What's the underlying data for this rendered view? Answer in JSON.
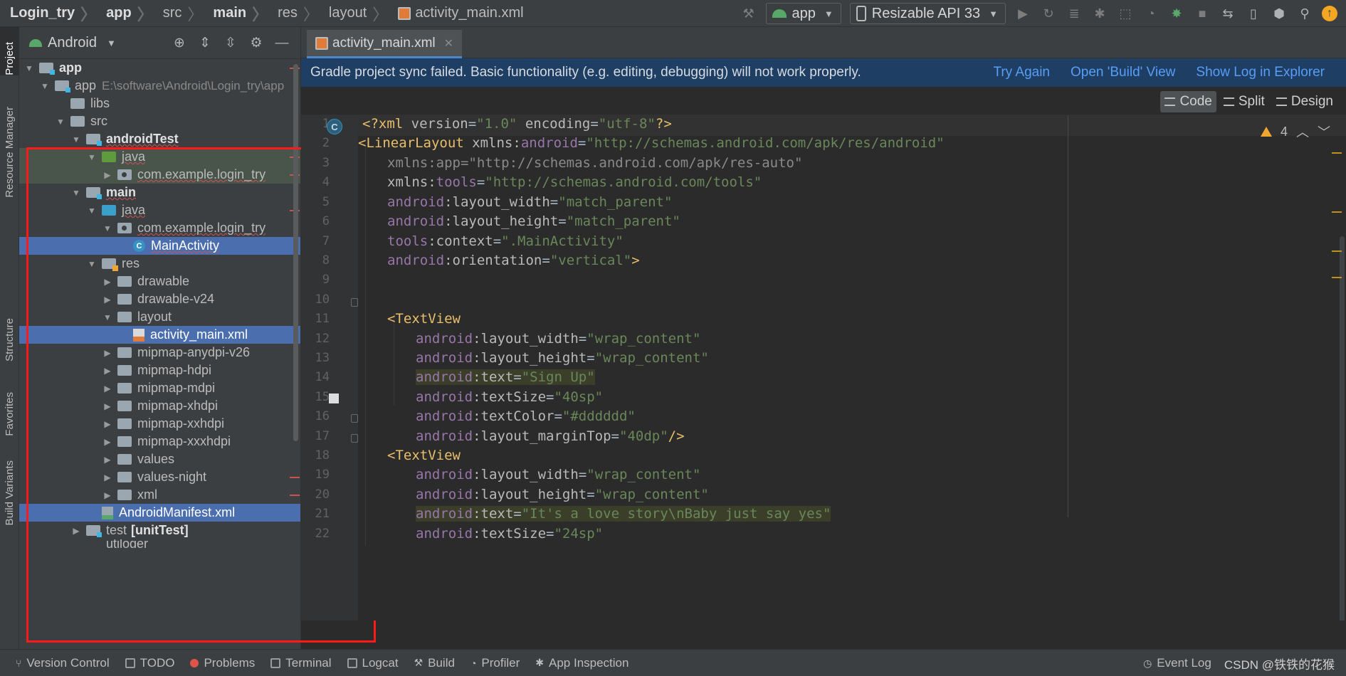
{
  "navbar": {
    "breadcrumbs": [
      "Login_try",
      "app",
      "src",
      "main",
      "res",
      "layout",
      "activity_main.xml"
    ],
    "run_config": "app",
    "device": "Resizable API 33",
    "update_badge": "↑"
  },
  "left_stripe": {
    "tabs": [
      "Project",
      "Resource Manager",
      "Structure",
      "Favorites",
      "Build Variants"
    ]
  },
  "project_panel": {
    "view_mode": "Android",
    "tree": [
      {
        "label": "app",
        "bold": true,
        "expanded": true
      },
      {
        "label": "app",
        "path": "E:\\software\\Android\\Login_try\\app",
        "expanded": true
      },
      {
        "label": "libs"
      },
      {
        "label": "src",
        "expanded": true
      },
      {
        "label": "androidTest",
        "bold": true,
        "expanded": true
      },
      {
        "label": "java",
        "expanded": true
      },
      {
        "label": "com.example.login_try",
        "expanded": false
      },
      {
        "label": "main",
        "bold": true,
        "expanded": true
      },
      {
        "label": "java",
        "expanded": true
      },
      {
        "label": "com.example.login_try",
        "expanded": true
      },
      {
        "label": "MainActivity",
        "selected": true,
        "class_icon": "C"
      },
      {
        "label": "res",
        "expanded": true
      },
      {
        "label": "drawable",
        "expanded": false
      },
      {
        "label": "drawable-v24",
        "expanded": false
      },
      {
        "label": "layout",
        "expanded": true
      },
      {
        "label": "activity_main.xml",
        "selected": true
      },
      {
        "label": "mipmap-anydpi-v26",
        "expanded": false
      },
      {
        "label": "mipmap-hdpi",
        "expanded": false
      },
      {
        "label": "mipmap-mdpi",
        "expanded": false
      },
      {
        "label": "mipmap-xhdpi",
        "expanded": false
      },
      {
        "label": "mipmap-xxhdpi",
        "expanded": false
      },
      {
        "label": "mipmap-xxxhdpi",
        "expanded": false
      },
      {
        "label": "values",
        "expanded": false
      },
      {
        "label": "values-night",
        "expanded": false
      },
      {
        "label": "xml",
        "expanded": false
      },
      {
        "label": "AndroidManifest.xml",
        "selected": true
      },
      {
        "label": "test",
        "suffix": "[unitTest]",
        "expanded": false
      },
      {
        "label": "utiloger"
      }
    ]
  },
  "editor": {
    "tab_title": "activity_main.xml",
    "sync_banner": {
      "message": "Gradle project sync failed. Basic functionality (e.g. editing, debugging) will not work properly.",
      "links": [
        "Try Again",
        "Open 'Build' View",
        "Show Log in Explorer"
      ]
    },
    "modes": [
      "Code",
      "Split",
      "Design"
    ],
    "active_mode": "Code",
    "warning_count": "4",
    "line_numbers": [
      "1",
      "2",
      "3",
      "4",
      "5",
      "6",
      "7",
      "8",
      "9",
      "10",
      "11",
      "12",
      "13",
      "14",
      "15",
      "16",
      "17",
      "18",
      "19",
      "20",
      "21",
      "22"
    ],
    "gutter_class_icon": "C",
    "code": {
      "l1": {
        "pre": "<?xml ",
        "a1": "version",
        "eq1": "=",
        "v1": "\"1.0\"",
        "sp": " ",
        "a2": "encoding",
        "eq2": "=",
        "v2": "\"utf-8\"",
        "post": "?>"
      },
      "l2": {
        "tag": "<LinearLayout",
        "sp": " ",
        "ns": "xmlns:",
        "nsn": "android",
        "eq": "=",
        "val": "\"http://schemas.android.com/apk/res/android\""
      },
      "l3": {
        "text": "xmlns:app=\"http://schemas.android.com/apk/res-auto\""
      },
      "l4": {
        "attr": "xmlns:",
        "ns": "tools",
        "eq": "=",
        "val": "\"http://schemas.android.com/tools\""
      },
      "l5": {
        "ns": "android",
        "attr": ":layout_width",
        "eq": "=",
        "val": "\"match_parent\""
      },
      "l6": {
        "ns": "android",
        "attr": ":layout_height",
        "eq": "=",
        "val": "\"match_parent\""
      },
      "l7": {
        "ns": "tools",
        "attr": ":context",
        "eq": "=",
        "val": "\".MainActivity\""
      },
      "l8": {
        "ns": "android",
        "attr": ":orientation",
        "eq": "=",
        "val": "\"vertical\"",
        "close": ">"
      },
      "l11": {
        "tag": "<TextView"
      },
      "l12": {
        "ns": "android",
        "attr": ":layout_width",
        "eq": "=",
        "val": "\"wrap_content\""
      },
      "l13": {
        "ns": "android",
        "attr": ":layout_height",
        "eq": "=",
        "val": "\"wrap_content\""
      },
      "l14": {
        "ns": "android",
        "attr": ":text",
        "eq": "=",
        "val": "\"Sign Up\""
      },
      "l15": {
        "ns": "android",
        "attr": ":textSize",
        "eq": "=",
        "val": "\"40sp\""
      },
      "l16": {
        "ns": "android",
        "attr": ":textColor",
        "eq": "=",
        "val": "\"#dddddd\""
      },
      "l17": {
        "ns": "android",
        "attr": ":layout_marginTop",
        "eq": "=",
        "val": "\"40dp\"",
        "close": "/>"
      },
      "l18": {
        "tag": "<TextView"
      },
      "l19": {
        "ns": "android",
        "attr": ":layout_width",
        "eq": "=",
        "val": "\"wrap_content\""
      },
      "l20": {
        "ns": "android",
        "attr": ":layout_height",
        "eq": "=",
        "val": "\"wrap_content\""
      },
      "l21": {
        "ns": "android",
        "attr": ":text",
        "eq": "=",
        "val": "\"It's a love story\\nBaby just say yes\""
      },
      "l22": {
        "ns": "android",
        "attr": ":textSize",
        "eq": "=",
        "val": "\"24sp\""
      }
    }
  },
  "bottom_bar": {
    "tools": [
      "Version Control",
      "TODO",
      "Problems",
      "Terminal",
      "Logcat",
      "Build",
      "Profiler",
      "App Inspection"
    ],
    "event_log": "Event Log",
    "watermark": "CSDN @铁铁的花猴"
  },
  "colors": {
    "selection": "#4b6eaf",
    "highlight_box": "#ff1a1a",
    "banner": "#1f3e63",
    "link": "#589df6",
    "xml_tag": "#e8bf6a",
    "xml_value": "#6a8759",
    "xml_namespace": "#9876aa"
  }
}
